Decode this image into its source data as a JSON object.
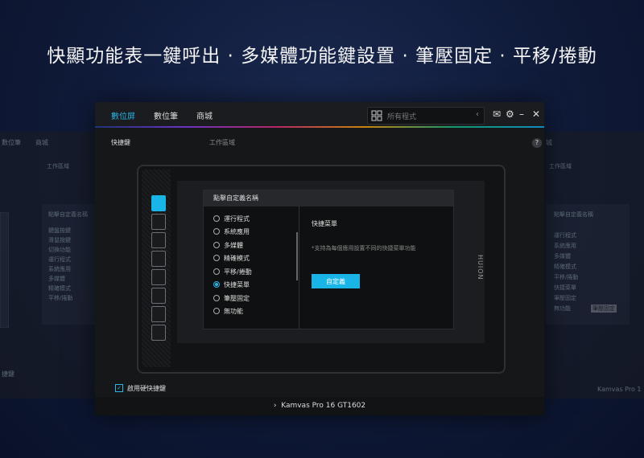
{
  "headline": "快顯功能表一鍵呼出 · 多媒體功能鍵設置 · 筆壓固定 · 平移/捲動",
  "ghost_left": {
    "tabs": [
      "數位筆",
      "商城"
    ],
    "work_area": "工作區域",
    "panel_title": "點擊自定義名稱",
    "items": [
      "鍵盤按鍵",
      "滑鼠按鍵",
      "切換功能",
      "運行程式",
      "系統應用",
      "多媒體",
      "精確模式",
      "平移/捲動"
    ],
    "footer_label": "捷鍵"
  },
  "ghost_right": {
    "tab": "城",
    "work_area": "工作區域",
    "panel_title": "點擊自定義名稱",
    "items": [
      "運行程式",
      "系統應用",
      "多媒體",
      "精確模式",
      "平移/捲動",
      "快捷菜單",
      "筆壓固定",
      "無功能"
    ],
    "tooltip": "筆壓固定",
    "footer": "Kamvas Pro 1"
  },
  "window": {
    "tabs": [
      "數位屏",
      "數位筆",
      "商城"
    ],
    "search_placeholder": "所有程式",
    "section_quick": "快捷鍵",
    "section_work": "工作區域",
    "help": "?",
    "brand": "HUION",
    "popup": {
      "title": "點擊自定義名稱",
      "items": [
        "運行程式",
        "系統應用",
        "多媒體",
        "精確模式",
        "平移/捲動",
        "快捷菜單",
        "筆壓固定",
        "無功能"
      ],
      "selected_index": 5,
      "right_title": "快捷菜單",
      "right_desc": "*支持為每個應用設置不同的快捷菜單功能",
      "button": "自定義"
    },
    "enable_label": "啟用硬快捷鍵",
    "device": "Kamvas Pro 16 GT1602",
    "chevron": "›"
  },
  "colors": {
    "accent": "#19b5e6",
    "background": "#0f1a38"
  }
}
